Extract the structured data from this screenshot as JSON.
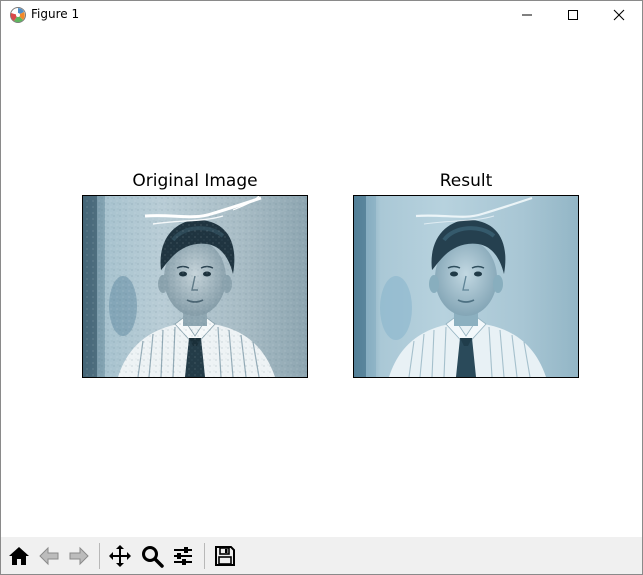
{
  "window": {
    "title": "Figure 1"
  },
  "figure": {
    "panels": [
      {
        "title": "Original Image",
        "image": "restoration-input-photo"
      },
      {
        "title": "Result",
        "image": "restoration-output-photo"
      }
    ]
  },
  "toolbar": {
    "tools": [
      "home-icon",
      "back-icon",
      "forward-icon",
      "pan-icon",
      "zoom-icon",
      "configure-subplots-icon",
      "save-icon"
    ]
  }
}
